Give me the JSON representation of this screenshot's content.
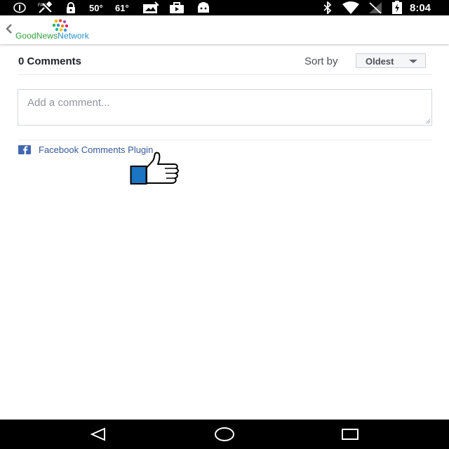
{
  "status_bar": {
    "temp1": "50°",
    "temp2": "61°",
    "time": "8:04",
    "icons": [
      "info-icon",
      "satellite-icon",
      "lock-icon",
      "photo-icon",
      "briefcase-icon",
      "android-icon",
      "bluetooth-icon",
      "wifi-icon",
      "no-signal-icon",
      "battery-charging-icon"
    ]
  },
  "app_bar": {
    "logo_good": "Good",
    "logo_news": "News",
    "logo_network": "Network"
  },
  "comments": {
    "count_label": "0 Comments",
    "sort_label": "Sort by",
    "sort_value": "Oldest",
    "input_placeholder": "Add a comment...",
    "plugin_link": "Facebook Comments Plugin"
  },
  "colors": {
    "fb_blue": "#4267b2",
    "link_blue": "#365899",
    "thumb_blue": "#1a75c2"
  },
  "nav_bar": {
    "icons": [
      "back-triangle-icon",
      "home-circle-icon",
      "recents-square-icon"
    ]
  }
}
